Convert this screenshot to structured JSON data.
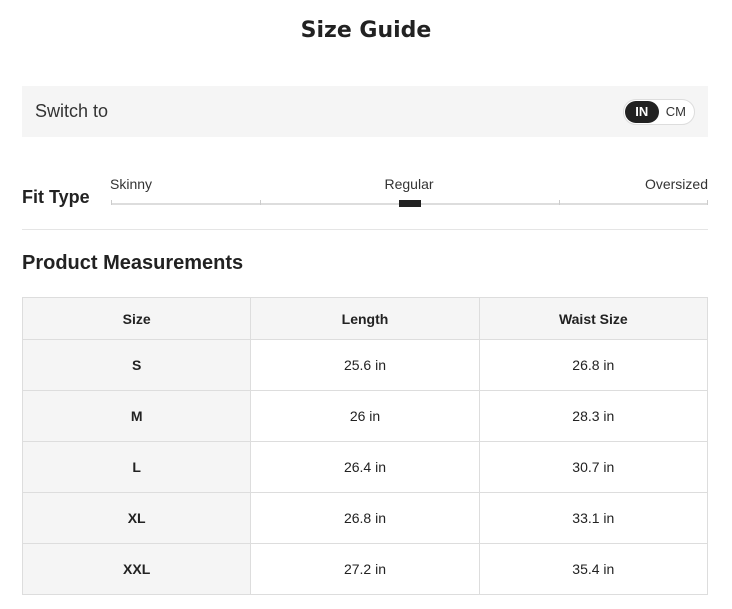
{
  "title": "Size Guide",
  "switch": {
    "label": "Switch to",
    "options": [
      "IN",
      "CM"
    ],
    "selected": "IN"
  },
  "fit": {
    "title": "Fit Type",
    "labels": [
      "Skinny",
      "Regular",
      "Oversized"
    ],
    "selected": "Regular",
    "position": 0.5
  },
  "measurements": {
    "title": "Product Measurements",
    "headers": [
      "Size",
      "Length",
      "Waist Size"
    ],
    "rows": [
      [
        "S",
        "25.6 in",
        "26.8 in"
      ],
      [
        "M",
        "26 in",
        "28.3 in"
      ],
      [
        "L",
        "26.4 in",
        "30.7 in"
      ],
      [
        "XL",
        "26.8 in",
        "33.1 in"
      ],
      [
        "XXL",
        "27.2 in",
        "35.4 in"
      ]
    ]
  },
  "colors": {
    "accent": "#222222",
    "panel": "#f5f5f5",
    "border": "#dddddd"
  }
}
